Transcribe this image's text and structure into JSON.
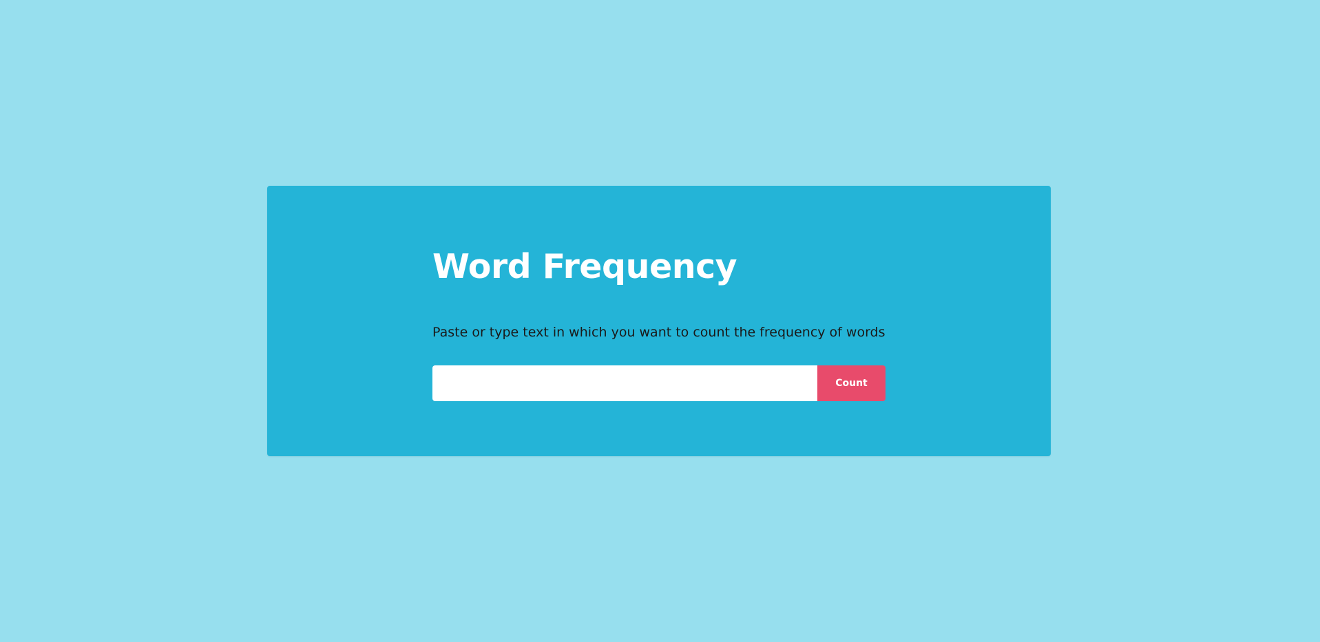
{
  "colors": {
    "page_background": "#97dfee",
    "card_background": "#24b4d7",
    "title_color": "#ffffff",
    "button_background": "#e84b6b",
    "button_text": "#ffffff"
  },
  "card": {
    "title": "Word Frequency",
    "instructions": "Paste or type text in which you want to count the frequency of words",
    "input": {
      "value": "",
      "placeholder": ""
    },
    "count_button_label": "Count"
  }
}
